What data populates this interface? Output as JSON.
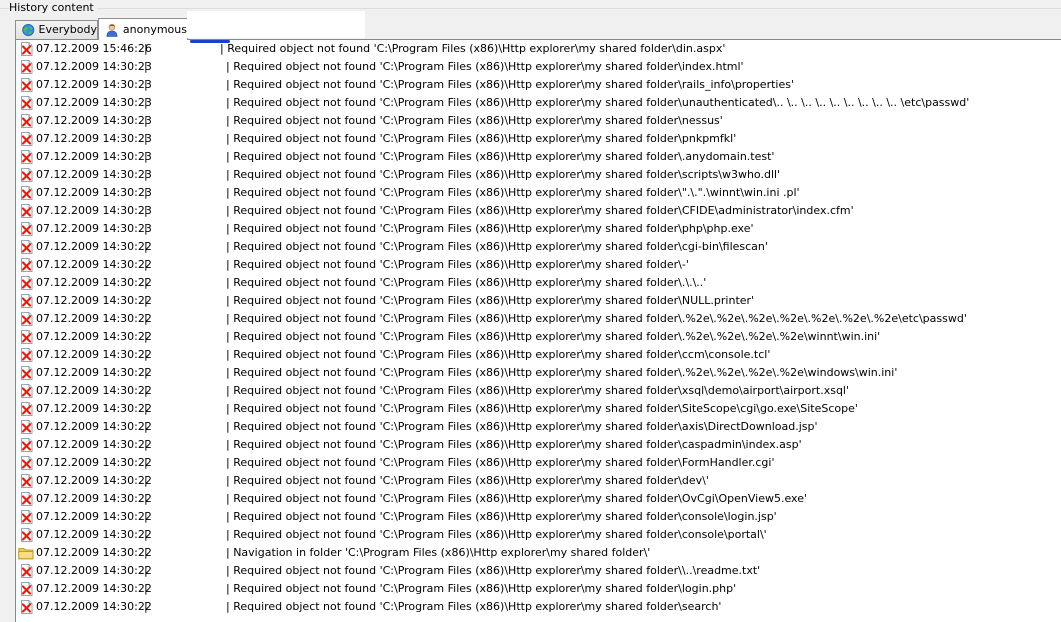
{
  "group": {
    "title": "History content"
  },
  "tabs": [
    {
      "label": "Everybody",
      "icon": "globe-icon",
      "active": false
    },
    {
      "label": "anonymous",
      "icon": "user-icon",
      "active": true
    }
  ],
  "separator": "|",
  "entries": [
    {
      "icon": "error-icon",
      "date": "07.12.2009 15:46:26",
      "msg": "| Required object not found 'C:\\Program Files (x86)\\Http explorer\\my shared folder\\din.aspx'"
    },
    {
      "icon": "error-icon",
      "date": "07.12.2009 14:30:23",
      "msg": "| Required object not found 'C:\\Program Files (x86)\\Http explorer\\my shared folder\\index.html'"
    },
    {
      "icon": "error-icon",
      "date": "07.12.2009 14:30:23",
      "msg": "| Required object not found 'C:\\Program Files (x86)\\Http explorer\\my shared folder\\rails_info\\properties'"
    },
    {
      "icon": "error-icon",
      "date": "07.12.2009 14:30:23",
      "msg": "| Required object not found 'C:\\Program Files (x86)\\Http explorer\\my shared folder\\unauthenticated\\..  \\..  \\..  \\..  \\..  \\..  \\..  \\..  \\..  \\etc\\passwd'"
    },
    {
      "icon": "error-icon",
      "date": "07.12.2009 14:30:23",
      "msg": "| Required object not found 'C:\\Program Files (x86)\\Http explorer\\my shared folder\\nessus'"
    },
    {
      "icon": "error-icon",
      "date": "07.12.2009 14:30:23",
      "msg": "| Required object not found 'C:\\Program Files (x86)\\Http explorer\\my shared folder\\pnkpmfkl'"
    },
    {
      "icon": "error-icon",
      "date": "07.12.2009 14:30:23",
      "msg": "| Required object not found 'C:\\Program Files (x86)\\Http explorer\\my shared folder\\.anydomain.test'"
    },
    {
      "icon": "error-icon",
      "date": "07.12.2009 14:30:23",
      "msg": "| Required object not found 'C:\\Program Files (x86)\\Http explorer\\my shared folder\\scripts\\w3who.dll'"
    },
    {
      "icon": "error-icon",
      "date": "07.12.2009 14:30:23",
      "msg": "| Required object not found 'C:\\Program Files (x86)\\Http explorer\\my shared folder\\\".\\.\".\\winnt\\win.ini .pl'"
    },
    {
      "icon": "error-icon",
      "date": "07.12.2009 14:30:23",
      "msg": "| Required object not found 'C:\\Program Files (x86)\\Http explorer\\my shared folder\\CFIDE\\administrator\\index.cfm'"
    },
    {
      "icon": "error-icon",
      "date": "07.12.2009 14:30:23",
      "msg": "| Required object not found 'C:\\Program Files (x86)\\Http explorer\\my shared folder\\php\\php.exe'"
    },
    {
      "icon": "error-icon",
      "date": "07.12.2009 14:30:22",
      "msg": "| Required object not found 'C:\\Program Files (x86)\\Http explorer\\my shared folder\\cgi-bin\\filescan'"
    },
    {
      "icon": "error-icon",
      "date": "07.12.2009 14:30:22",
      "msg": "| Required object not found 'C:\\Program Files (x86)\\Http explorer\\my shared folder\\-'"
    },
    {
      "icon": "error-icon",
      "date": "07.12.2009 14:30:22",
      "msg": "| Required object not found 'C:\\Program Files (x86)\\Http explorer\\my shared folder\\.\\.\\..'"
    },
    {
      "icon": "error-icon",
      "date": "07.12.2009 14:30:22",
      "msg": "| Required object not found 'C:\\Program Files (x86)\\Http explorer\\my shared folder\\NULL.printer'"
    },
    {
      "icon": "error-icon",
      "date": "07.12.2009 14:30:22",
      "msg": "| Required object not found 'C:\\Program Files (x86)\\Http explorer\\my shared folder\\.%2e\\.%2e\\.%2e\\.%2e\\.%2e\\.%2e\\.%2e\\etc\\passwd'"
    },
    {
      "icon": "error-icon",
      "date": "07.12.2009 14:30:22",
      "msg": "| Required object not found 'C:\\Program Files (x86)\\Http explorer\\my shared folder\\.%2e\\.%2e\\.%2e\\.%2e\\winnt\\win.ini'"
    },
    {
      "icon": "error-icon",
      "date": "07.12.2009 14:30:22",
      "msg": "| Required object not found 'C:\\Program Files (x86)\\Http explorer\\my shared folder\\ccm\\console.tcl'"
    },
    {
      "icon": "error-icon",
      "date": "07.12.2009 14:30:22",
      "msg": "| Required object not found 'C:\\Program Files (x86)\\Http explorer\\my shared folder\\.%2e\\.%2e\\.%2e\\.%2e\\windows\\win.ini'"
    },
    {
      "icon": "error-icon",
      "date": "07.12.2009 14:30:22",
      "msg": "| Required object not found 'C:\\Program Files (x86)\\Http explorer\\my shared folder\\xsql\\demo\\airport\\airport.xsql'"
    },
    {
      "icon": "error-icon",
      "date": "07.12.2009 14:30:22",
      "msg": "| Required object not found 'C:\\Program Files (x86)\\Http explorer\\my shared folder\\SiteScope\\cgi\\go.exe\\SiteScope'"
    },
    {
      "icon": "error-icon",
      "date": "07.12.2009 14:30:22",
      "msg": "| Required object not found 'C:\\Program Files (x86)\\Http explorer\\my shared folder\\axis\\DirectDownload.jsp'"
    },
    {
      "icon": "error-icon",
      "date": "07.12.2009 14:30:22",
      "msg": "| Required object not found 'C:\\Program Files (x86)\\Http explorer\\my shared folder\\caspadmin\\index.asp'"
    },
    {
      "icon": "error-icon",
      "date": "07.12.2009 14:30:22",
      "msg": "| Required object not found 'C:\\Program Files (x86)\\Http explorer\\my shared folder\\FormHandler.cgi'"
    },
    {
      "icon": "error-icon",
      "date": "07.12.2009 14:30:22",
      "msg": "| Required object not found 'C:\\Program Files (x86)\\Http explorer\\my shared folder\\dev\\'"
    },
    {
      "icon": "error-icon",
      "date": "07.12.2009 14:30:22",
      "msg": "| Required object not found 'C:\\Program Files (x86)\\Http explorer\\my shared folder\\OvCgi\\OpenView5.exe'"
    },
    {
      "icon": "error-icon",
      "date": "07.12.2009 14:30:22",
      "msg": "| Required object not found 'C:\\Program Files (x86)\\Http explorer\\my shared folder\\console\\login.jsp'"
    },
    {
      "icon": "error-icon",
      "date": "07.12.2009 14:30:22",
      "msg": "| Required object not found 'C:\\Program Files (x86)\\Http explorer\\my shared folder\\console\\portal\\'"
    },
    {
      "icon": "folder-icon",
      "date": "07.12.2009 14:30:22",
      "msg": "| Navigation in folder 'C:\\Program Files (x86)\\Http explorer\\my shared folder\\'"
    },
    {
      "icon": "error-icon",
      "date": "07.12.2009 14:30:22",
      "msg": "| Required object not found 'C:\\Program Files (x86)\\Http explorer\\my shared folder\\\\..\\readme.txt'"
    },
    {
      "icon": "error-icon",
      "date": "07.12.2009 14:30:22",
      "msg": "| Required object not found 'C:\\Program Files (x86)\\Http explorer\\my shared folder\\login.php'"
    },
    {
      "icon": "error-icon",
      "date": "07.12.2009 14:30:22",
      "msg": "| Required object not found 'C:\\Program Files (x86)\\Http explorer\\my shared folder\\search'"
    }
  ]
}
